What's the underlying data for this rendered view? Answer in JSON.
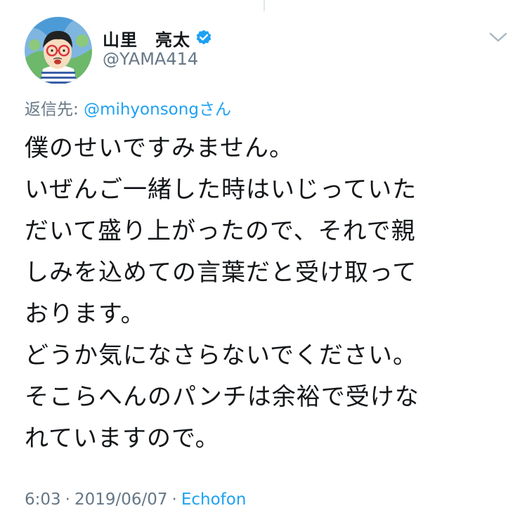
{
  "tweet": {
    "author": {
      "display_name": "山里　亮太",
      "handle": "@YAMA414",
      "verified": true,
      "avatar_icon": "avatar-illustration"
    },
    "reply": {
      "prefix": "返信先: ",
      "mention": "@mihyonsong",
      "suffix": "さん"
    },
    "text_lines": [
      "僕のせいですみません。",
      "いぜんご一緒した時はいじっていた",
      "だいて盛り上がったので、それで親",
      "しみを込めての言葉だと受け取って",
      "おります。",
      "どうか気になさらないでください。",
      "そこらへんのパンチは余裕で受けな",
      "れていますので。"
    ],
    "meta": {
      "time": "6:03",
      "separator": "·",
      "date": "2019/06/07",
      "source": "Echofon"
    }
  },
  "icons": {
    "verified": "verified-badge-icon",
    "menu": "chevron-down-icon"
  },
  "colors": {
    "accent": "#1da1f2",
    "secondary_text": "#657786",
    "primary_text": "#14171a",
    "divider": "#e1e8ed"
  }
}
